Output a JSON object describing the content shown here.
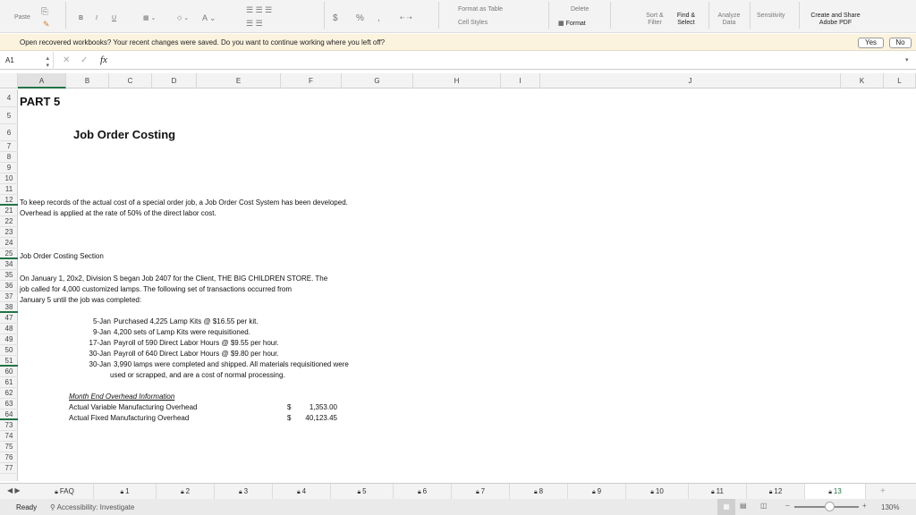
{
  "ribbon": {
    "paste": "Paste",
    "bold": "B",
    "italic": "I",
    "underline": "U",
    "currency": "$",
    "percent": "%",
    "comma": ",",
    "format_as_table": "Format as Table",
    "cell_styles": "Cell Styles",
    "delete": "Delete",
    "format": "Format",
    "sort_filter": "Sort & Filter",
    "find_select": "Find & Select",
    "analyze_data": "Analyze Data",
    "sensitivity": "Sensitivity",
    "adobe_pdf": "Create and Share Adobe PDF"
  },
  "notice": {
    "message": "Open recovered workbooks?  Your recent changes were saved. Do you want to continue working where you left off?",
    "yes": "Yes",
    "no": "No"
  },
  "formula_bar": {
    "name_box": "A1",
    "fx": "fx",
    "value": ""
  },
  "columns": [
    "A",
    "B",
    "C",
    "D",
    "E",
    "F",
    "G",
    "H",
    "I",
    "J",
    "K",
    "L"
  ],
  "rows": [
    "4",
    "5",
    "6",
    "7",
    "8",
    "9",
    "10",
    "11",
    "12",
    "21",
    "22",
    "23",
    "24",
    "25",
    "34",
    "35",
    "36",
    "37",
    "38",
    "47",
    "48",
    "49",
    "50",
    "51",
    "60",
    "61",
    "62",
    "63",
    "64",
    "73",
    "74",
    "75",
    "76",
    "77"
  ],
  "sheet": {
    "part": "PART 5",
    "title": "Job Order Costing",
    "intro1": "To keep records of the actual cost of a special order job, a Job Order Cost System has been developed.",
    "intro2": "Overhead is applied at the rate of 50% of the direct labor cost.",
    "section": "Job Order Costing Section",
    "p1": "On January 1, 20x2, Division S began Job 2407 for the Client, THE BIG CHILDREN STORE.  The",
    "p2": "job called for 4,000 customized lamps.  The following set of transactions occurred from",
    "p3": "January 5 until the job was completed:",
    "transactions": [
      {
        "date": "5-Jan",
        "text": "Purchased 4,225 Lamp Kits @  $16.55 per kit."
      },
      {
        "date": "9-Jan",
        "text": "4,200 sets of Lamp Kits were requisitioned."
      },
      {
        "date": "17-Jan",
        "text": "Payroll of 590 Direct Labor Hours @ $9.55 per hour."
      },
      {
        "date": "30-Jan",
        "text": "Payroll of 640 Direct Labor Hours @ $9.80 per hour."
      },
      {
        "date": "30-Jan",
        "text": "3,990 lamps were completed and shipped.  All materials requisitioned were"
      }
    ],
    "transaction_cont": "used or scrapped, and are a cost of normal processing.",
    "overhead_title": "Month End Overhead Information",
    "overhead": [
      {
        "label": "Actual Variable Manufacturing Overhead",
        "cur": "$",
        "amount": "1,353.00"
      },
      {
        "label": "Actual Fixed Manufacturing Overhead",
        "cur": "$",
        "amount": "40,123.45"
      }
    ]
  },
  "tabs": [
    "FAQ",
    "1",
    "2",
    "3",
    "4",
    "5",
    "6",
    "7",
    "8",
    "9",
    "10",
    "11",
    "12",
    "13"
  ],
  "active_tab": "13",
  "status": {
    "ready": "Ready",
    "accessibility": "Accessibility: Investigate",
    "zoom": "130%"
  },
  "colors": {
    "accent": "#217346",
    "notice_bg": "#fcf3df"
  }
}
